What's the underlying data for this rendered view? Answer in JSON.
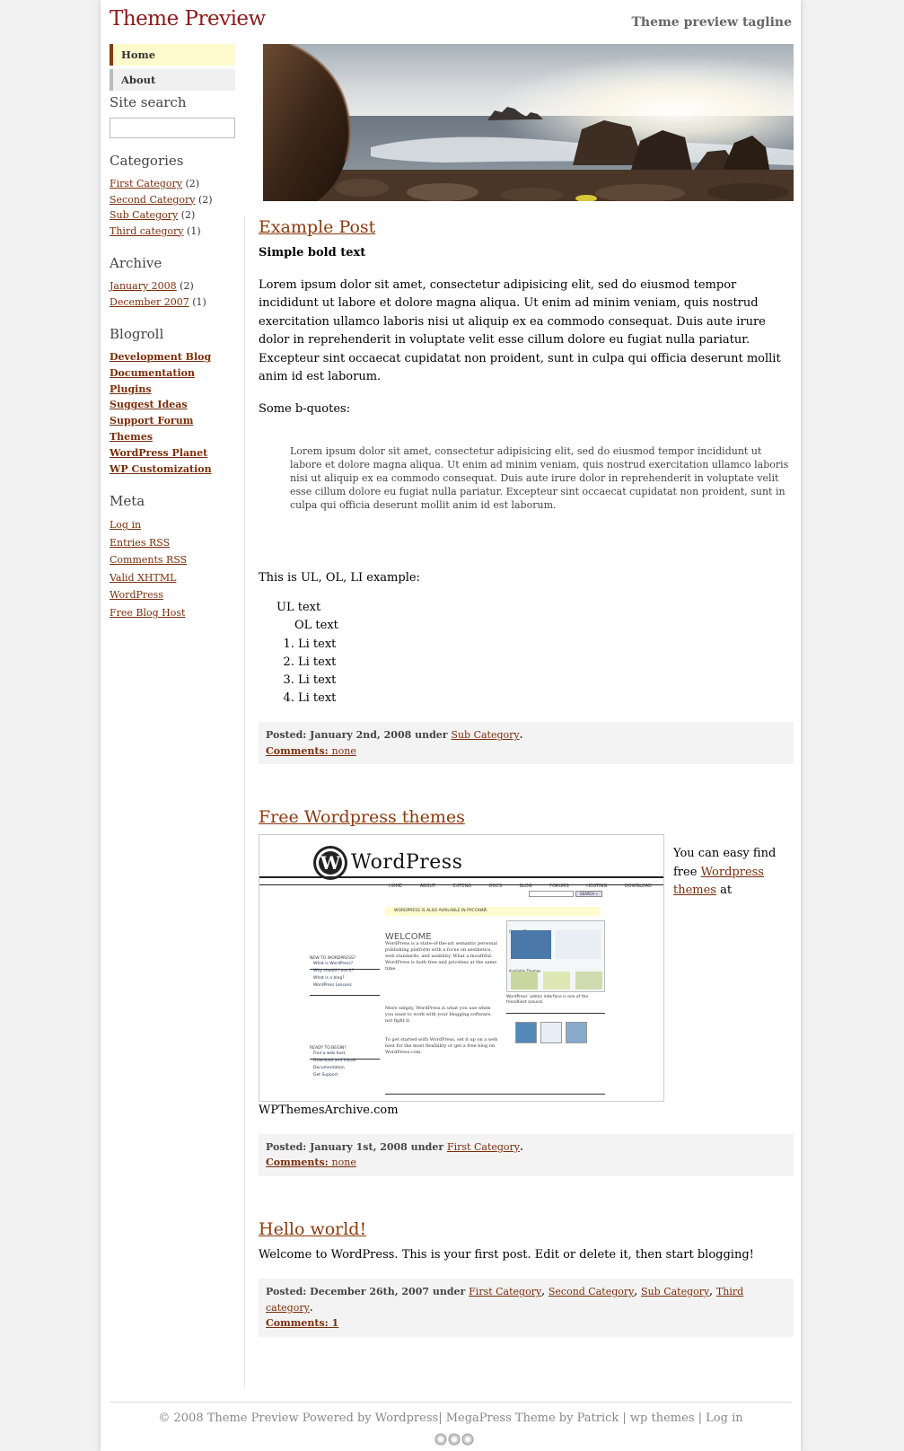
{
  "site": {
    "title": "Theme Preview",
    "tagline": "Theme preview tagline"
  },
  "nav": [
    {
      "label": "Home",
      "active": true
    },
    {
      "label": "About",
      "active": false
    }
  ],
  "sidebar": {
    "search_heading": "Site search",
    "search_value": "",
    "categories_heading": "Categories",
    "categories": [
      {
        "label": "First Category",
        "count": "(2)"
      },
      {
        "label": "Second Category",
        "count": "(2)"
      },
      {
        "label": "Sub Category",
        "count": "(2)"
      },
      {
        "label": "Third category",
        "count": "(1)"
      }
    ],
    "archive_heading": "Archive",
    "archive": [
      {
        "label": "January 2008",
        "count": "(2)"
      },
      {
        "label": "December 2007",
        "count": "(1)"
      }
    ],
    "blogroll_heading": "Blogroll",
    "blogroll": [
      "Development Blog",
      "Documentation",
      "Plugins",
      "Suggest Ideas",
      "Support Forum",
      "Themes",
      "WordPress Planet",
      "WP Customization"
    ],
    "meta_heading": "Meta",
    "meta": [
      "Log in",
      "Entries RSS",
      "Comments RSS",
      "Valid XHTML",
      "WordPress",
      "Free Blog Host"
    ]
  },
  "posts": [
    {
      "title": "Example Post",
      "bold_text": "Simple bold text",
      "paragraph": "Lorem ipsum dolor sit amet, consectetur adipisicing elit, sed do eiusmod tempor incididunt ut labore et dolore magna aliqua. Ut enim ad minim veniam, quis nostrud exercitation ullamco laboris nisi ut aliquip ex ea commodo consequat. Duis aute irure dolor in reprehenderit in voluptate velit esse cillum dolore eu fugiat nulla pariatur. Excepteur sint occaecat cupidatat non proident, sunt in culpa qui officia deserunt mollit anim id est laborum.",
      "bquote_intro": "Some b-quotes:",
      "blockquote": "Lorem ipsum dolor sit amet, consectetur adipisicing elit, sed do eiusmod tempor incididunt ut labore et dolore magna aliqua. Ut enim ad minim veniam, quis nostrud exercitation ullamco laboris nisi ut aliquip ex ea commodo consequat. Duis aute irure dolor in reprehenderit in voluptate velit esse cillum dolore eu fugiat nulla pariatur. Excepteur sint occaecat cupidatat non proident, sunt in culpa qui officia deserunt mollit anim id est laborum.",
      "list_intro": "This is UL, OL, LI example:",
      "ul_text": "UL text",
      "ol_text": "OL text",
      "li_items": [
        "Li text",
        "Li text",
        "Li text",
        "Li text"
      ],
      "meta": {
        "posted_label": "Posted: January 2nd, 2008 under",
        "categories": [
          "Sub Category"
        ],
        "comments_label": "Comments:",
        "comments_value": "none"
      }
    },
    {
      "title": "Free Wordpress themes",
      "side_text_before": "You can easy find free",
      "side_link": "Wordpress themes",
      "side_text_after": "at",
      "caption": "WPThemesArchive.com",
      "meta": {
        "posted_label": "Posted: January 1st, 2008 under",
        "categories": [
          "First Category"
        ],
        "comments_label": "Comments:",
        "comments_value": "none"
      }
    },
    {
      "title": "Hello world!",
      "paragraph": "Welcome to WordPress. This is your first post. Edit or delete it, then start blogging!",
      "meta": {
        "posted_label": "Posted: December 26th, 2007 under",
        "categories": [
          "First Category",
          "Second Category",
          "Sub Category",
          "Third category"
        ],
        "comments_label": "Comments:",
        "comments_value": "1"
      }
    }
  ],
  "wp_screenshot": {
    "logo_text": "WordPress",
    "nav": [
      "HOME",
      "ABOUT",
      "EXTEND",
      "DOCS",
      "BLOG",
      "FORUMS",
      "HOSTING",
      "DOWNLOAD"
    ],
    "search_button": "SEARCH »",
    "notice": "WORDPRESS IS ALSO AVAILABLE IN РУССКИЙ.",
    "welcome": "WELCOME",
    "new_heading": "NEW TO WORDPRESS?",
    "new_links": [
      "What is WordPress?",
      "Why should I use it?",
      "What is a blog?",
      "WordPress Lessons"
    ],
    "ready_heading": "READY TO BEGIN?",
    "ready_links": [
      "Find a web host",
      "Download and Install",
      "Documentation",
      "Get Support"
    ],
    "body1": "WordPress is a state-of-the-art semantic personal publishing platform with a focus on aesthetics, web standards, and usability. What a mouthful. WordPress is both free and priceless at the same time.",
    "body2": "More simply, WordPress is what you use when you want to work with your blogging software, not fight it.",
    "body3": "To get started with WordPress, set it up on a web host for the most flexibility or get a free blog on WordPress.com.",
    "current_theme": "Current Theme",
    "available_themes": "Available Themes",
    "caption": "WordPress' admin interface is one of the friendliest around."
  },
  "footer": {
    "copyright": "© 2008 Theme Preview Powered by",
    "wordpress": "Wordpress",
    "megapress": "MegaPress Theme by Patrick",
    "wp_themes": "wp themes",
    "login": "Log in"
  },
  "colors": {
    "title": "#8b1a1a",
    "link": "#7a2e0a",
    "post_title": "#8b3a0e",
    "nav_active_bg": "#fffacd",
    "meta_bg": "#f3f3f3"
  }
}
